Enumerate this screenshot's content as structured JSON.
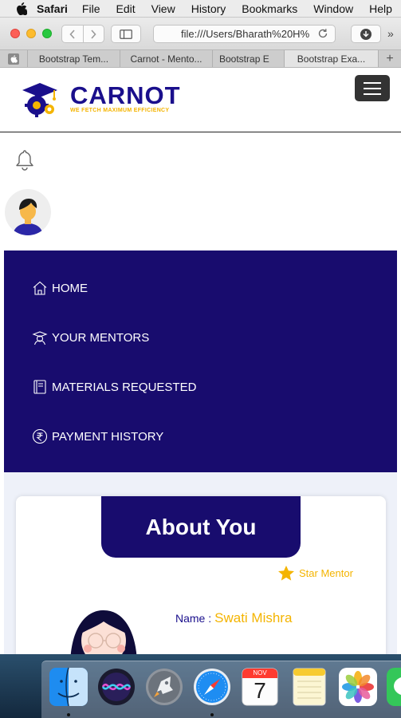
{
  "menubar": {
    "app": "Safari",
    "items": [
      "File",
      "Edit",
      "View",
      "History",
      "Bookmarks",
      "Window",
      "Help"
    ]
  },
  "browser": {
    "url": "file:///Users/Bharath%20H%",
    "tabs": [
      "Bootstrap Tem...",
      "Carnot - Mento...",
      "Bootstrap E",
      "Bootstrap Exa..."
    ]
  },
  "site": {
    "logo_title": "CARNOT",
    "logo_tagline": "WE FETCH MAXIMUM EFFICIENCY",
    "nav": [
      "HOME",
      "YOUR MENTORS",
      "MATERIALS REQUESTED",
      "PAYMENT HISTORY"
    ],
    "about_heading": "About You",
    "badge": "Star Mentor",
    "name_label": "Name :",
    "name_value": "Swati Mishra"
  },
  "dock": {
    "calendar_month": "NOV",
    "calendar_day": "7"
  },
  "colors": {
    "brand_navy": "#180c6e",
    "brand_gold": "#f4b400",
    "page_bg": "#eef1f9"
  }
}
